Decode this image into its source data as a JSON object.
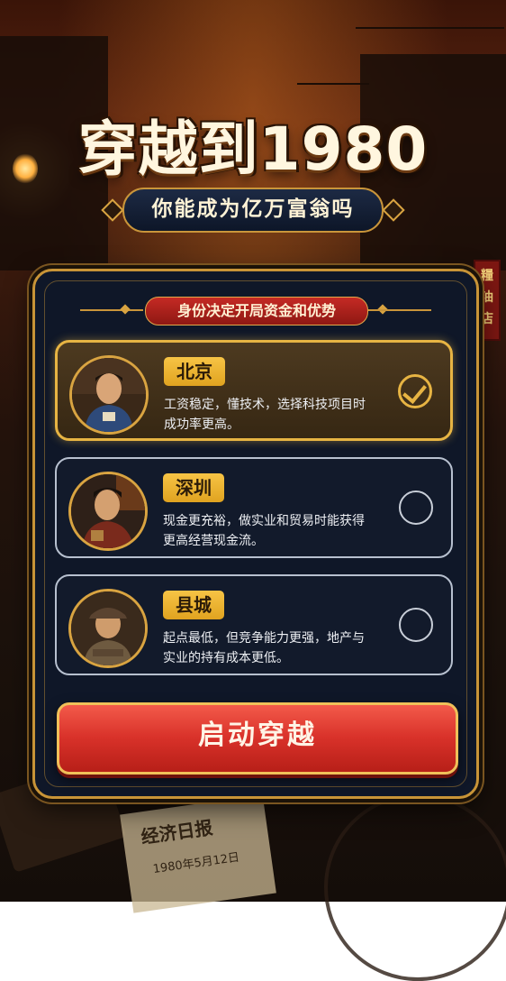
{
  "title": "穿越到1980",
  "subtitle": "你能成为亿万富翁吗",
  "panel": {
    "badge": "身份决定开局资金和优势",
    "options": [
      {
        "city": "北京",
        "desc_line1": "工资稳定，懂技术，选择科技项目时",
        "desc_line2": "成功率更高。",
        "selected": true,
        "icon": "check-icon"
      },
      {
        "city": "深圳",
        "desc_line1": "现金更充裕，做实业和贸易时能获得",
        "desc_line2": "更高经营现金流。",
        "selected": false
      },
      {
        "city": "县城",
        "desc_line1": "起点最低，但竞争能力更强，地产与",
        "desc_line2": "实业的持有成本更低。",
        "selected": false
      }
    ],
    "start_button": "启动穿越"
  },
  "background": {
    "shop_sign": "糧油店",
    "newspaper_title": "经济日报",
    "newspaper_date": "1980年5月12日"
  },
  "colors": {
    "gold": "#e7b443",
    "panel_bg": "#0f1728",
    "button_red": "#d9322a",
    "tag_yellow": "#f7c445"
  }
}
